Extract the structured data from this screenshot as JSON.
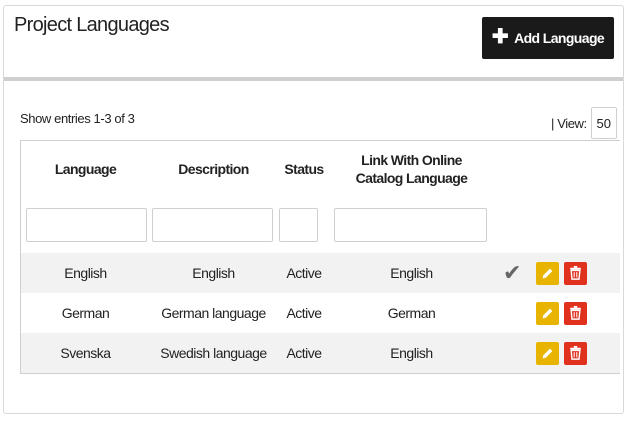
{
  "panel": {
    "title": "Project Languages",
    "add_button_label": "Add Language"
  },
  "toolbar": {
    "entries_info": "Show entries 1-3 of 3",
    "view_label": "| View:",
    "view_value": "50"
  },
  "table": {
    "headers": [
      "Language",
      "Description",
      "Status",
      "Link With Online Catalog Language"
    ],
    "filters": [
      {
        "value": "",
        "placeholder": ""
      },
      {
        "value": "",
        "placeholder": ""
      },
      {
        "value": "",
        "placeholder": ""
      },
      {
        "value": "",
        "placeholder": ""
      }
    ],
    "rows": [
      {
        "language": "English",
        "description": "English",
        "status": "Active",
        "catalog_language": "English",
        "is_default": true
      },
      {
        "language": "German",
        "description": "German language",
        "status": "Active",
        "catalog_language": "German",
        "is_default": false
      },
      {
        "language": "Svenska",
        "description": "Swedish language",
        "status": "Active",
        "catalog_language": "English",
        "is_default": false
      }
    ]
  },
  "icons": {
    "add": "plus-icon",
    "default_marker": "checkmark-icon",
    "edit": "pencil-icon",
    "delete": "trash-icon"
  },
  "colors": {
    "primary_button": "#1a1a1a",
    "edit_button": "#e8b400",
    "delete_button": "#e0301e",
    "row_stripe": "#f2f2f2"
  }
}
